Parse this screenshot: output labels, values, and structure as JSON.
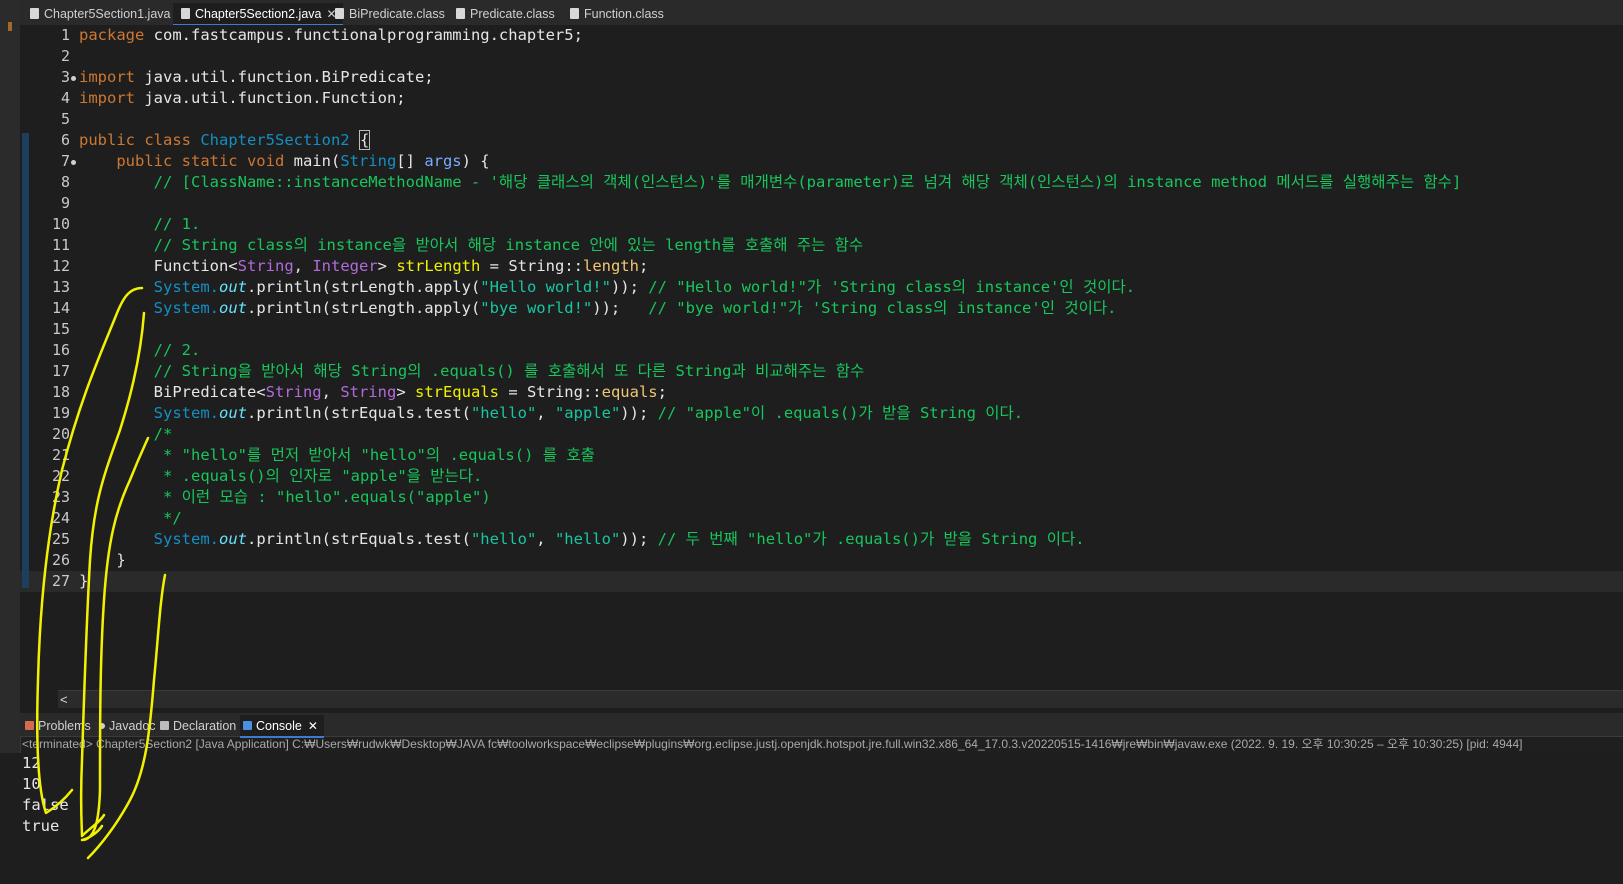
{
  "tabs": [
    {
      "label": "Chapter5Section1.java",
      "active": false
    },
    {
      "label": "Chapter5Section2.java",
      "active": true,
      "close": "✕"
    },
    {
      "label": "BiPredicate.class",
      "active": false
    },
    {
      "label": "Predicate.class",
      "active": false
    },
    {
      "label": "Function.class",
      "active": false
    }
  ],
  "editor": {
    "line_numbers": [
      "1",
      "2",
      "3",
      "4",
      "5",
      "6",
      "7",
      "8",
      "9",
      "10",
      "11",
      "12",
      "13",
      "14",
      "15",
      "16",
      "17",
      "18",
      "19",
      "20",
      "21",
      "22",
      "23",
      "24",
      "25",
      "26",
      "27"
    ],
    "code": {
      "l1_kw": "package",
      "l1_pkg": " com.fastcampus.functionalprogramming.chapter5;",
      "l3_kw": "import",
      "l3_rest": " java.util.function.BiPredicate;",
      "l4_kw": "import",
      "l4_rest": " java.util.function.Function;",
      "l6_kw": "public class ",
      "l6_cls": "Chapter5Section2",
      "l6_brace": "{",
      "l7_kw": "public static void ",
      "l7_main": "main(",
      "l7_type": "String",
      "l7_arr": "[] ",
      "l7_param": "args",
      "l7_end": ") {",
      "l8_comment": "// [ClassName::instanceMethodName - '해당 클래스의 객체(인스턴스)'를 매개변수(parameter)로 넘겨 해당 객체(인스턴스)의 instance method 메서드를 실행해주는 함수]",
      "l10_comment": "// 1.",
      "l11_comment": "// String class의 instance을 받아서 해당 instance 안에 있는 length를 호출해 주는 함수",
      "l12_func": "Function<",
      "l12_t1": "String",
      "l12_sep": ", ",
      "l12_t2": "Integer",
      "l12_gt": "> ",
      "l12_var": "strLength",
      "l12_eq": " = String::",
      "l12_ref": "length",
      "l12_end": ";",
      "l13_sys": "System.",
      "l13_out": "out",
      "l13_call": ".println(strLength.apply(",
      "l13_str": "\"Hello world!\"",
      "l13_close": ")); ",
      "l13_comment": "// \"Hello world!\"가 'String class의 instance'인 것이다.",
      "l14_sys": "System.",
      "l14_out": "out",
      "l14_call": ".println(strLength.apply(",
      "l14_str": "\"bye world!\"",
      "l14_close": "));   ",
      "l14_comment": "// \"bye world!\"가 'String class의 instance'인 것이다.",
      "l16_comment": "// 2.",
      "l17_comment": "// String을 받아서 해당 String의 .equals() 를 호출해서 또 다른 String과 비교해주는 함수",
      "l18_pred": "BiPredicate<",
      "l18_t1": "String",
      "l18_sep": ", ",
      "l18_t2": "String",
      "l18_gt": "> ",
      "l18_var": "strEquals",
      "l18_eq": " = String::",
      "l18_ref": "equals",
      "l18_end": ";",
      "l19_sys": "System.",
      "l19_out": "out",
      "l19_call": ".println(strEquals.test(",
      "l19_s1": "\"hello\"",
      "l19_sep": ", ",
      "l19_s2": "\"apple\"",
      "l19_close": ")); ",
      "l19_comment": "// \"apple\"이 .equals()가 받을 String 이다.",
      "l20_comment": "/*",
      "l21_comment": " * \"hello\"를 먼저 받아서 \"hello\"의 .equals() 를 호출",
      "l22_comment": " * .equals()의 인자로 \"apple\"을 받는다.",
      "l23_comment": " * 이런 모습 : \"hello\".equals(\"apple\")",
      "l24_comment": " */",
      "l25_sys": "System.",
      "l25_out": "out",
      "l25_call": ".println(strEquals.test(",
      "l25_s1": "\"hello\"",
      "l25_sep": ", ",
      "l25_s2": "\"hello\"",
      "l25_close": ")); ",
      "l25_comment": "// 두 번째 \"hello\"가 .equals()가 받을 String 이다.",
      "l26_brace": "}",
      "l27_brace": "}"
    }
  },
  "scroll": {
    "left_arrow": "<"
  },
  "panel_tabs": [
    {
      "label": "Problems",
      "icon_color": "#d66a4a"
    },
    {
      "label": "Javadoc",
      "icon_color": "#d0d0d0"
    },
    {
      "label": "Declaration",
      "icon_color": "#bcbcbc"
    },
    {
      "label": "Console",
      "icon_color": "#4a8fe0",
      "active": true,
      "close": "✕"
    }
  ],
  "console": {
    "status": "<terminated> Chapter5Section2 [Java Application] C:₩Users₩rudwk₩Desktop₩JAVA fc₩toolworkspace₩eclipse₩plugins₩org.eclipse.justj.openjdk.hotspot.jre.full.win32.x86_64_17.0.3.v20220515-1416₩jre₩bin₩javaw.exe  (2022. 9. 19. 오후 10:30:25 – 오후 10:30:25) [pid: 4944]",
    "output": [
      "12",
      "10",
      "false",
      "true"
    ]
  },
  "colors": {
    "keyword": "#cc7832",
    "class_name": "#1290c3",
    "type_param": "#b26adb",
    "comment": "#17c65c",
    "string": "#17c6a3",
    "static_field": "#66e1f8",
    "annotation_pen": "#f2f200"
  }
}
